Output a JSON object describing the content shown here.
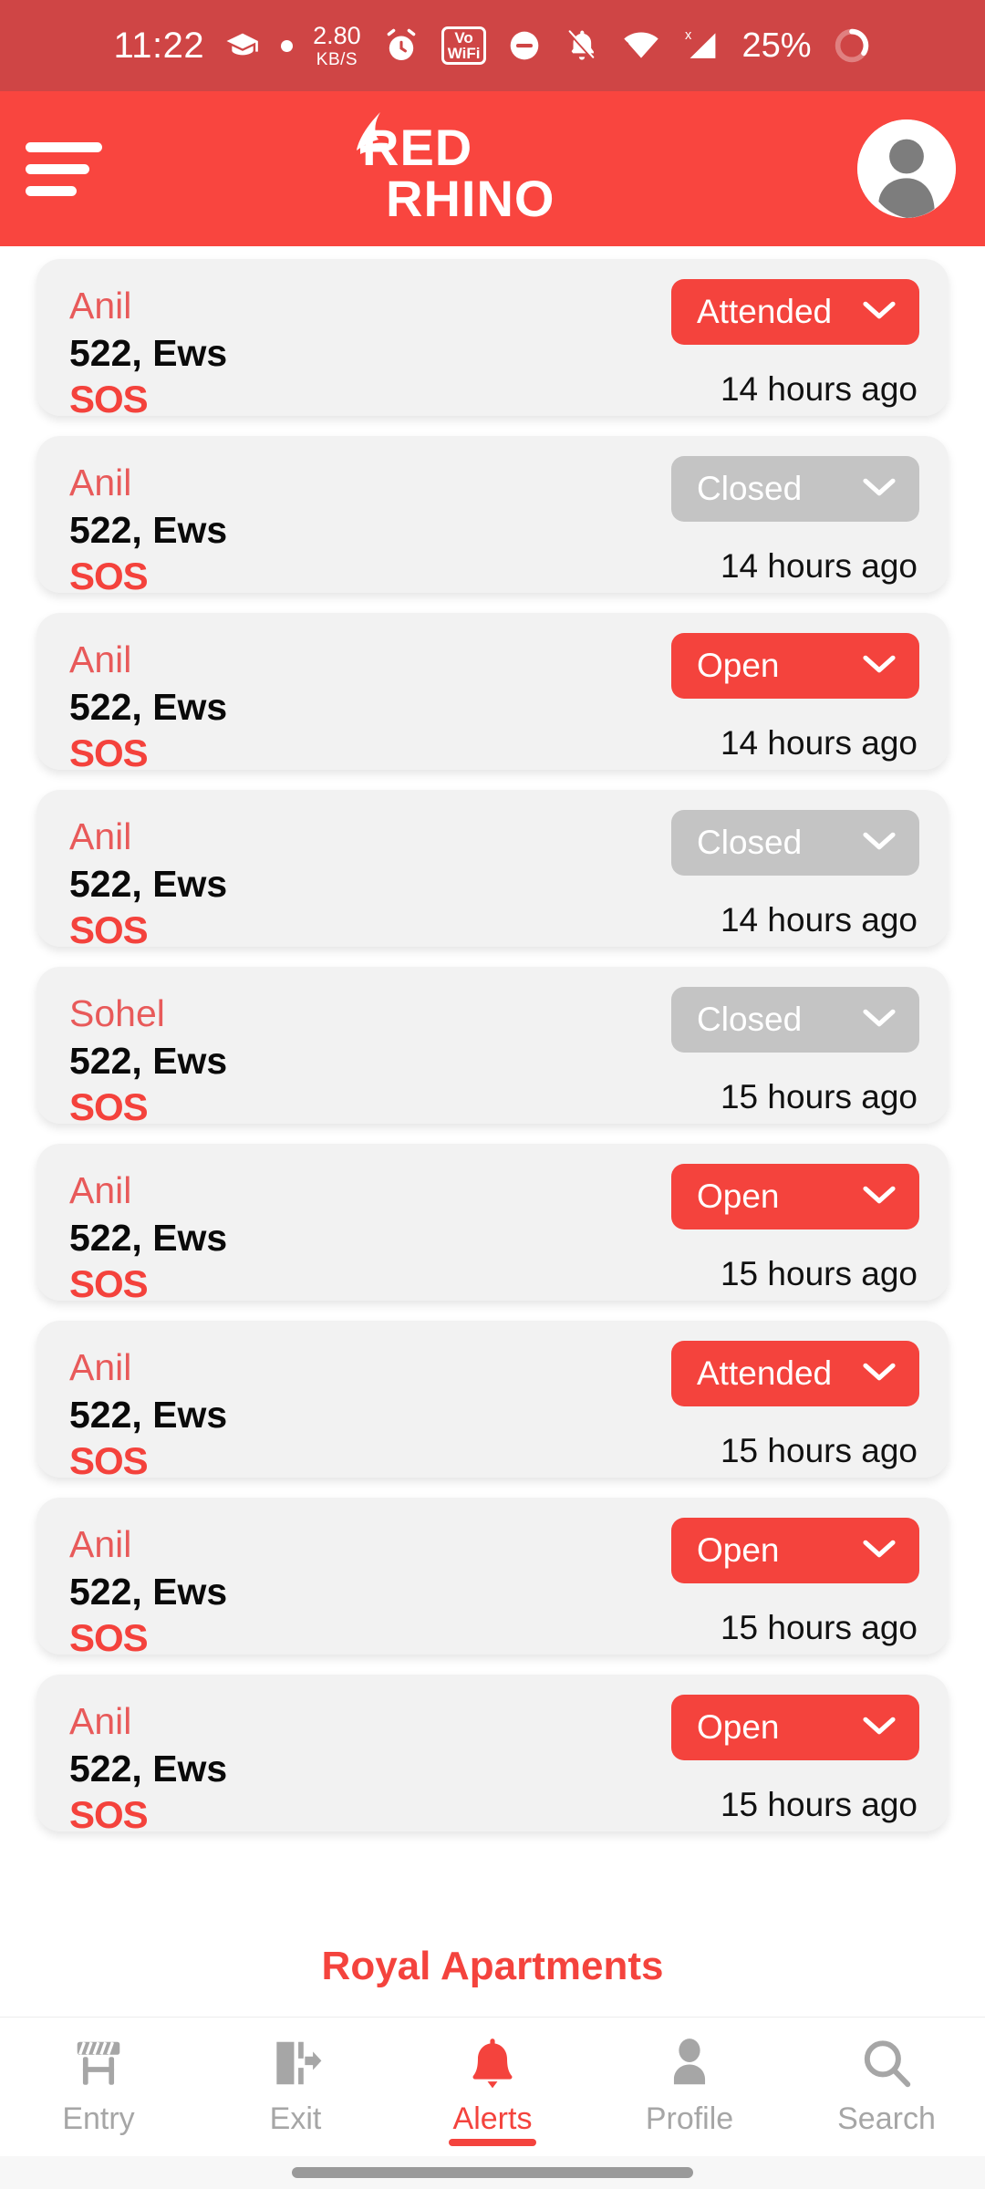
{
  "statusbar": {
    "time": "11:22",
    "network_speed_value": "2.80",
    "network_speed_unit": "KB/S",
    "vowifi_line1": "Vo",
    "vowifi_line2": "WiFi",
    "battery_percent": "25%",
    "icons": [
      "graduation-cap-icon",
      "dot-icon",
      "alarm-icon",
      "vowifi-icon",
      "do-not-disturb-icon",
      "bell-muted-icon",
      "wifi-icon",
      "signal-no-service-icon",
      "battery-icon"
    ]
  },
  "header": {
    "menu_icon": "hamburger-icon",
    "logo_line1": "RED",
    "logo_line2": "RHINO",
    "avatar_icon": "user-avatar-icon",
    "brand_color": "#F9453F"
  },
  "alerts": [
    {
      "name": "Anil",
      "flat": "522, Ews",
      "type": "SOS",
      "status": "Attended",
      "status_style": "attended",
      "time": "14 hours ago"
    },
    {
      "name": "Anil",
      "flat": "522, Ews",
      "type": "SOS",
      "status": "Closed",
      "status_style": "closed",
      "time": "14 hours ago"
    },
    {
      "name": "Anil",
      "flat": "522, Ews",
      "type": "SOS",
      "status": "Open",
      "status_style": "open",
      "time": "14 hours ago"
    },
    {
      "name": "Anil",
      "flat": "522, Ews",
      "type": "SOS",
      "status": "Closed",
      "status_style": "closed",
      "time": "14 hours ago"
    },
    {
      "name": "Sohel",
      "flat": "522, Ews",
      "type": "SOS",
      "status": "Closed",
      "status_style": "closed",
      "time": "15 hours ago"
    },
    {
      "name": "Anil",
      "flat": "522, Ews",
      "type": "SOS",
      "status": "Open",
      "status_style": "open",
      "time": "15 hours ago"
    },
    {
      "name": "Anil",
      "flat": "522, Ews",
      "type": "SOS",
      "status": "Attended",
      "status_style": "attended",
      "time": "15 hours ago"
    },
    {
      "name": "Anil",
      "flat": "522, Ews",
      "type": "SOS",
      "status": "Open",
      "status_style": "open",
      "time": "15 hours ago"
    },
    {
      "name": "Anil",
      "flat": "522, Ews",
      "type": "SOS",
      "status": "Open",
      "status_style": "open",
      "time": "15 hours ago"
    }
  ],
  "footer": {
    "property_name": "Royal Apartments",
    "nav": [
      {
        "label": "Entry",
        "icon": "barrier-gate-icon",
        "active": false
      },
      {
        "label": "Exit",
        "icon": "exit-door-icon",
        "active": false
      },
      {
        "label": "Alerts",
        "icon": "bell-icon",
        "active": true
      },
      {
        "label": "Profile",
        "icon": "person-icon",
        "active": false
      },
      {
        "label": "Search",
        "icon": "magnifier-icon",
        "active": false
      }
    ]
  },
  "colors": {
    "accent": "#F4433D",
    "header": "#F9453F",
    "statusbar": "#CF4545",
    "closed": "#C4C4C4",
    "card": "#F2F2F2"
  }
}
